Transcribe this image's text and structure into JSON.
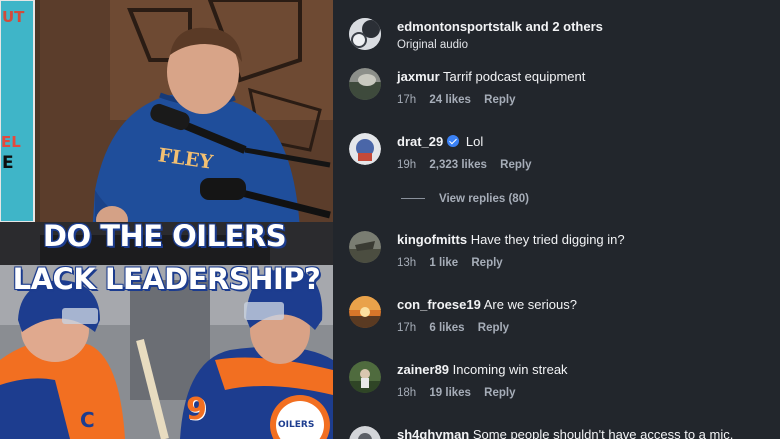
{
  "post": {
    "authors_user": "edmontonsportstalk",
    "authors_suffix": "and 2 others",
    "audio": "Original audio"
  },
  "media": {
    "headline_line1": "DO THE OILERS",
    "headline_line2": "LACK LEADERSHIP?",
    "sign_text_top": "UT",
    "sign_text_mid": "EL",
    "sign_text_bottom": "E",
    "hoodie_text": "FLEY",
    "jersey_number": "9",
    "jersey_c": "C",
    "jersey_logo": "OILERS"
  },
  "comments": [
    {
      "user": "jaxmur",
      "text": "Tarrif podcast equipment",
      "time": "17h",
      "likes": "24 likes",
      "reply": "Reply",
      "verified": false
    },
    {
      "user": "drat_29",
      "text": "Lol",
      "time": "19h",
      "likes": "2,323 likes",
      "reply": "Reply",
      "verified": true
    },
    {
      "user": "kingofmitts",
      "text": "Have they tried digging in?",
      "time": "13h",
      "likes": "1 like",
      "reply": "Reply",
      "verified": false
    },
    {
      "user": "con_froese19",
      "text": "Are we serious?",
      "time": "17h",
      "likes": "6 likes",
      "reply": "Reply",
      "verified": false
    },
    {
      "user": "zainer89",
      "text": "Incoming win streak",
      "time": "18h",
      "likes": "19 likes",
      "reply": "Reply",
      "verified": false
    },
    {
      "user": "sh4ghyman",
      "text": "Some people shouldn't have access to a mic.",
      "time": "",
      "likes": "",
      "reply": "",
      "verified": false
    }
  ],
  "view_replies": "View replies (80)",
  "colors": {
    "panel_bg": "#22262c",
    "verified_blue": "#3b82f6",
    "oilers_orange": "#f26f21",
    "oilers_blue": "#1d3d8f"
  }
}
